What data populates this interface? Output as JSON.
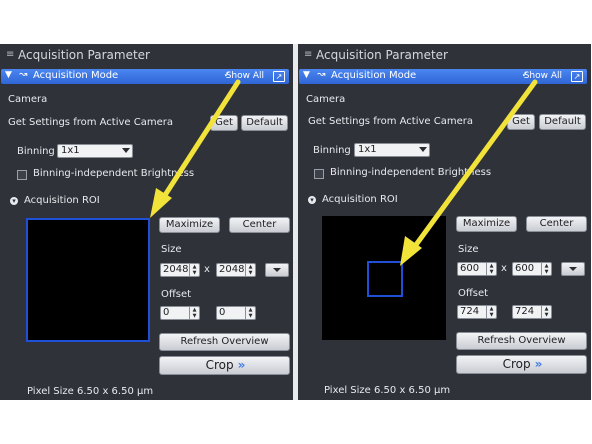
{
  "colors": {
    "panel_bg": "#2f3239",
    "mode_bar": "#3b78e7",
    "roi_outline": "#2050d8",
    "annotation_arrow": "#f2e33a"
  },
  "panels": [
    {
      "title": "Acquisition Parameter",
      "mode_bar": {
        "label": "Acquisition Mode",
        "show_all": "Show All",
        "icon": "camera-mode-icon"
      },
      "camera_label": "Camera",
      "get_settings_label": "Get Settings from Active Camera",
      "get_button": "Get",
      "default_button": "Default",
      "binning_label": "Binning",
      "binning_value": "1x1",
      "binning_brightness_label": "Binning-independent Brightness",
      "roi_section_label": "Acquisition ROI",
      "maximize_button": "Maximize",
      "center_button": "Center",
      "size_label": "Size",
      "size_width": "2048",
      "size_height": "2048",
      "times_sign": "x",
      "offset_label": "Offset",
      "offset_x": "0",
      "offset_y": "0",
      "refresh_button": "Refresh Overview",
      "crop_button": "Crop",
      "pixel_size": "Pixel Size  6.50 x 6.50 µm"
    },
    {
      "title": "Acquisition Parameter",
      "mode_bar": {
        "label": "Acquisition Mode",
        "show_all": "Show All",
        "icon": "camera-mode-icon"
      },
      "camera_label": "Camera",
      "get_settings_label": "Get Settings from Active Camera",
      "get_button": "Get",
      "default_button": "Default",
      "binning_label": "Binning",
      "binning_value": "1x1",
      "binning_brightness_label": "Binning-independent Brightness",
      "roi_section_label": "Acquisition ROI",
      "maximize_button": "Maximize",
      "center_button": "Center",
      "size_label": "Size",
      "size_width": "600",
      "size_height": "600",
      "times_sign": "x",
      "offset_label": "Offset",
      "offset_x": "724",
      "offset_y": "724",
      "refresh_button": "Refresh Overview",
      "crop_button": "Crop",
      "pixel_size": "Pixel Size  6.50 x 6.50 µm"
    }
  ]
}
